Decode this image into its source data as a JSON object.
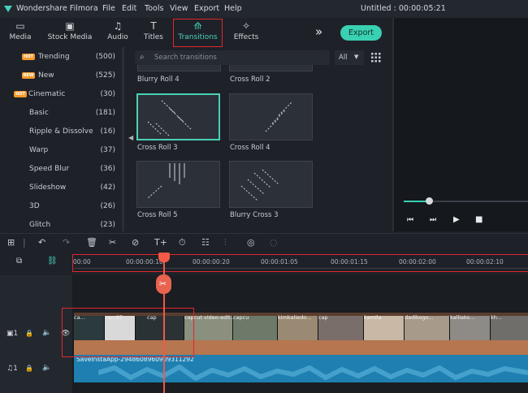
{
  "app": {
    "name": "Wondershare Filmora",
    "document": "Untitled : 00:00:05:21"
  },
  "menu": [
    "File",
    "Edit",
    "Tools",
    "View",
    "Export",
    "Help"
  ],
  "toolbar": {
    "tabs": [
      {
        "label": "Media",
        "icon": "folder-icon"
      },
      {
        "label": "Stock Media",
        "icon": "stock-media-icon"
      },
      {
        "label": "Audio",
        "icon": "music-note-icon"
      },
      {
        "label": "Titles",
        "icon": "text-t-icon"
      },
      {
        "label": "Transitions",
        "icon": "transitions-icon"
      },
      {
        "label": "Effects",
        "icon": "sparkle-icon"
      }
    ],
    "active_tab": "Transitions",
    "expand_glyph": "»",
    "export_label": "Export"
  },
  "sidebar": {
    "items": [
      {
        "label": "Trending",
        "count": "(500)",
        "badge": "HOT"
      },
      {
        "label": "New",
        "count": "(525)",
        "badge": "NEW"
      },
      {
        "label": "Cinematic",
        "count": "(30)",
        "badge": "HOT"
      },
      {
        "label": "Basic",
        "count": "(181)"
      },
      {
        "label": "Ripple & Dissolve",
        "count": "(16)"
      },
      {
        "label": "Warp",
        "count": "(37)"
      },
      {
        "label": "Speed Blur",
        "count": "(36)"
      },
      {
        "label": "Slideshow",
        "count": "(42)"
      },
      {
        "label": "3D",
        "count": "(26)"
      },
      {
        "label": "Glitch",
        "count": "(23)"
      }
    ]
  },
  "browser": {
    "search_placeholder": "Search transitions",
    "filter_value": "All",
    "thumbnails": [
      {
        "label": "Blurry Roll 4"
      },
      {
        "label": "Cross Roll 2"
      },
      {
        "label": "Cross Roll 3",
        "selected": true
      },
      {
        "label": "Cross Roll 4"
      },
      {
        "label": "Cross Roll 5"
      },
      {
        "label": "Blurry Cross 3"
      }
    ]
  },
  "player": {
    "progress": 0.2
  },
  "timeline": {
    "ruler_ticks": [
      "00:00",
      "00:00:00:10",
      "00:00:00:20",
      "00:00:01:05",
      "00:00:01:15",
      "00:00:02:00",
      "00:00:02:10"
    ],
    "clips": [
      "ca...",
      "ca...07",
      "cap",
      "capcut video-edit...",
      "capcu",
      "kimkaliedo...",
      "cap",
      "kamila",
      "dadikogo...",
      "kalliaks...",
      "kh..."
    ],
    "audio_clip": "SaveInstaApp-2948608960909311292"
  },
  "colors": {
    "accent": "#3ad0b2",
    "highlight": "#e0282e",
    "playhead": "#f25a47",
    "video_track": "#b57650",
    "audio_track": "#1e7fb0"
  }
}
